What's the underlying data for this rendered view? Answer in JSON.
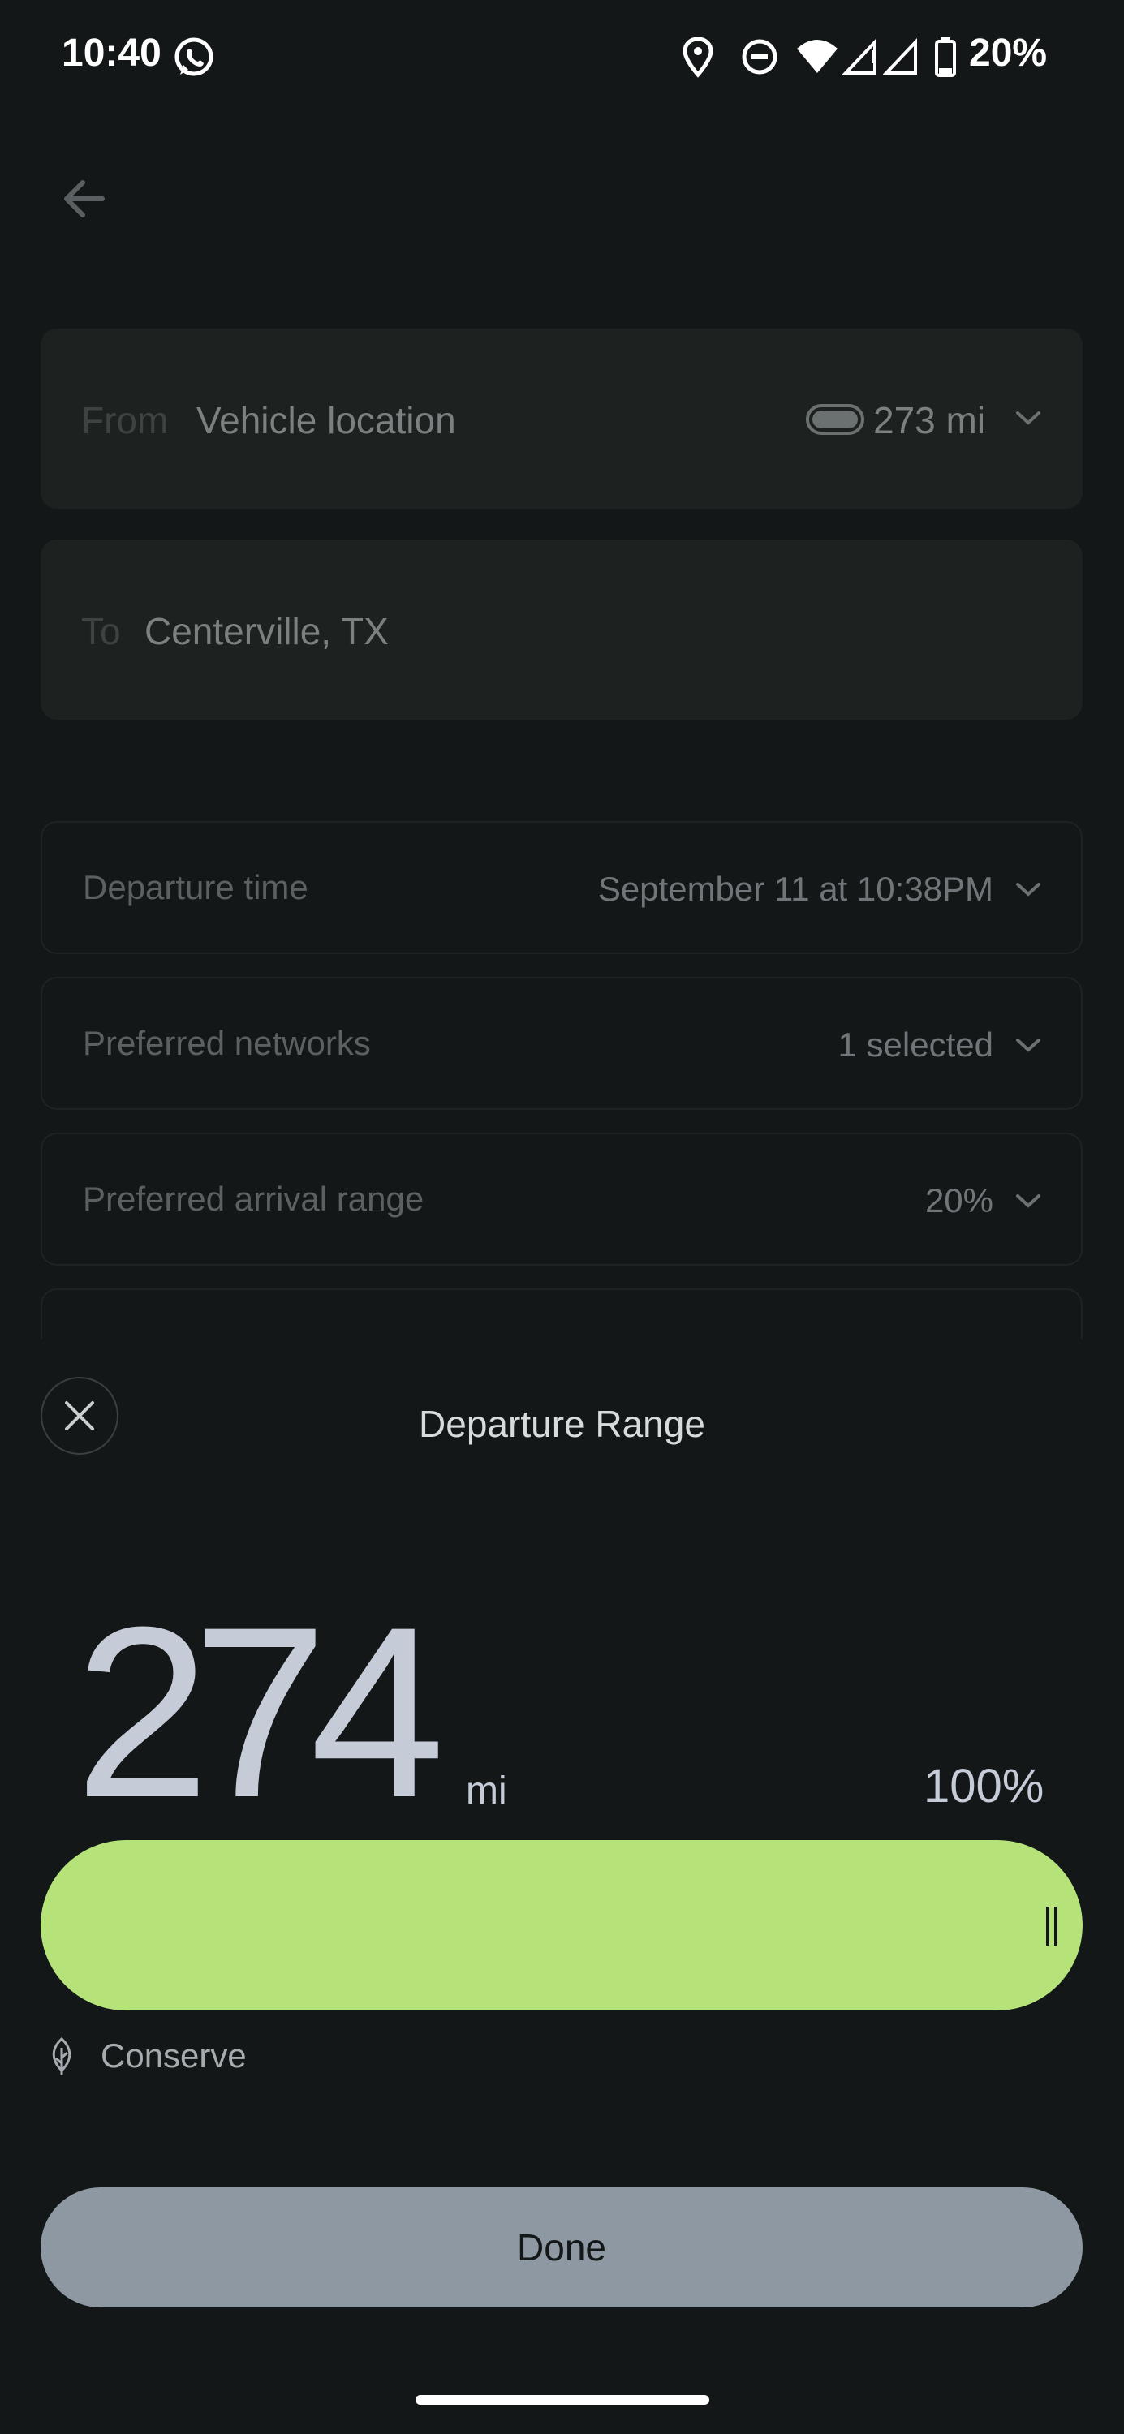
{
  "status_bar": {
    "time": "10:40",
    "battery": "20%",
    "icons": [
      "whatsapp-icon",
      "location-icon",
      "dnd-icon",
      "wifi-icon",
      "signal-icon",
      "signal-icon",
      "battery-icon"
    ]
  },
  "form": {
    "from_label": "From",
    "from_value": "Vehicle location",
    "vehicle_range": "273 mi",
    "to_label": "To",
    "to_value": "Centerville, TX",
    "options": [
      {
        "label": "Departure time",
        "value": "September 11 at 10:38PM"
      },
      {
        "label": "Preferred networks",
        "value": "1 selected"
      },
      {
        "label": "Preferred arrival range",
        "value": "20%"
      }
    ]
  },
  "sheet": {
    "title": "Departure Range",
    "range_value": "274",
    "range_unit": "mi",
    "charge_percent": "100%",
    "charge_fraction": 1.0,
    "mode_label": "Conserve",
    "done_label": "Done"
  },
  "colors": {
    "accent": "#b5e37a",
    "background": "#141718",
    "button": "#8d98a2"
  }
}
